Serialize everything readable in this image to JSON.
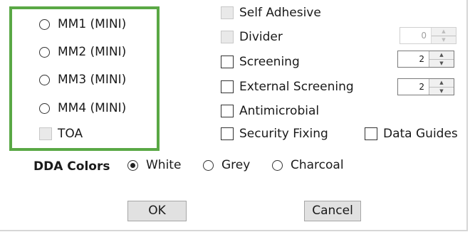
{
  "mini_options": [
    {
      "label": "MM1 (MINI)",
      "type": "radio",
      "checked": false
    },
    {
      "label": "MM2 (MINI)",
      "type": "radio",
      "checked": false
    },
    {
      "label": "MM3 (MINI)",
      "type": "radio",
      "checked": false
    },
    {
      "label": "MM4 (MINI)",
      "type": "radio",
      "checked": false
    },
    {
      "label": "TOA",
      "type": "checkbox",
      "checked": false,
      "disabled": true
    }
  ],
  "options": {
    "self_adhesive": "Self Adhesive",
    "divider": "Divider",
    "screening": "Screening",
    "external_screening": "External Screening",
    "antimicrobial": "Antimicrobial",
    "security_fixing": "Security Fixing",
    "data_guides": "Data Guides"
  },
  "spinners": {
    "divider": "0",
    "screening": "2",
    "external_screening": "2"
  },
  "dda": {
    "label": "DDA Colors",
    "choices": [
      {
        "label": "White",
        "checked": true
      },
      {
        "label": "Grey",
        "checked": false
      },
      {
        "label": "Charcoal",
        "checked": false
      }
    ]
  },
  "buttons": {
    "ok": "OK",
    "cancel": "Cancel"
  },
  "colors": {
    "highlight_border": "#5aa845"
  }
}
